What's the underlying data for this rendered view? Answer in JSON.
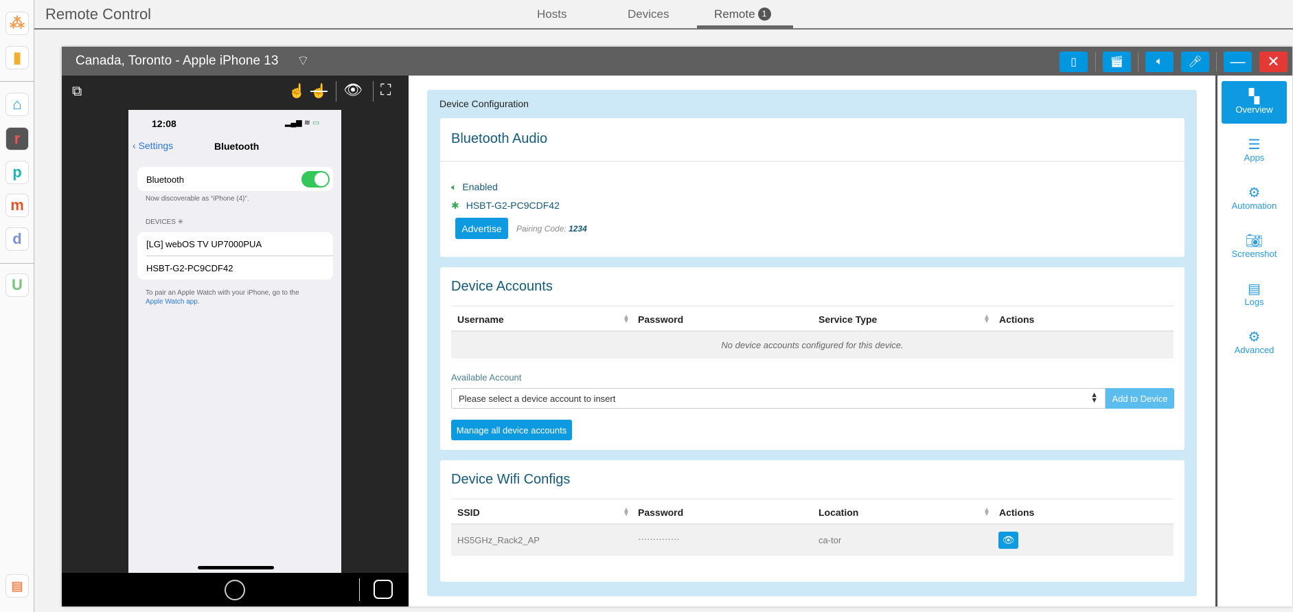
{
  "header": {
    "title": "Remote Control",
    "tabs": [
      {
        "label": "Hosts"
      },
      {
        "label": "Devices"
      },
      {
        "label": "Remote",
        "badge": "1",
        "active": true
      }
    ]
  },
  "window": {
    "title": "Canada, Toronto - Apple iPhone 13",
    "buttons": [
      "phone-icon",
      "clapperboard-icon",
      "volume-icon",
      "microphone-icon",
      "minimize-icon",
      "close-icon"
    ]
  },
  "phone": {
    "time": "12:08",
    "back_label": "Settings",
    "screen_title": "Bluetooth",
    "bt_label": "Bluetooth",
    "bt_on": true,
    "discoverable": "Now discoverable as “iPhone (4)”.",
    "devices_header": "DEVICES",
    "devices": [
      "[LG] webOS TV UP7000PUA",
      "HSBT-G2-PC9CDF42"
    ],
    "watch_note": "To pair an Apple Watch with your iPhone, go to the",
    "watch_link": "Apple Watch app",
    "watch_end": "."
  },
  "config": {
    "title": "Device Configuration",
    "bluetooth": {
      "heading": "Bluetooth Audio",
      "status": "Enabled",
      "device": "HSBT-G2-PC9CDF42",
      "advertise_label": "Advertise",
      "pairing_label": "Pairing Code:",
      "pairing_code": "1234"
    },
    "accounts": {
      "heading": "Device Accounts",
      "columns": [
        "Username",
        "Password",
        "Service Type",
        "Actions"
      ],
      "empty": "No device accounts configured for this device.",
      "available_label": "Available Account",
      "select_placeholder": "Please select a device account to insert",
      "add_label": "Add to Device",
      "manage_label": "Manage all device accounts"
    },
    "wifi": {
      "heading": "Device Wifi Configs",
      "columns": [
        "SSID",
        "Password",
        "Location",
        "Actions"
      ],
      "rows": [
        {
          "ssid": "HS5GHz_Rack2_AP",
          "password": "··············",
          "location": "ca-tor"
        }
      ]
    }
  },
  "right_nav": [
    {
      "label": "Overview",
      "active": true
    },
    {
      "label": "Apps"
    },
    {
      "label": "Automation"
    },
    {
      "label": "Screenshot"
    },
    {
      "label": "Logs"
    },
    {
      "label": "Advanced"
    }
  ],
  "colors": {
    "accent": "#0e9ae0",
    "panel": "#cde8f6",
    "heading": "#145a7a",
    "close": "#e53935",
    "enabled": "#3aa757"
  }
}
